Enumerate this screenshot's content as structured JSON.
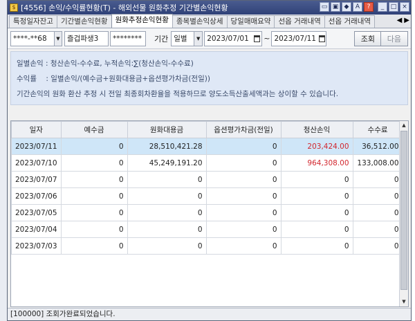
{
  "window": {
    "title": "[4556] 손익/수익률현황(T) - 해외선물 원화추정 기간별손익현황",
    "icon_glyph": "$"
  },
  "tabs": [
    {
      "label": "특정일자잔고",
      "active": false
    },
    {
      "label": "기간별손익현황",
      "active": false
    },
    {
      "label": "원화추정손익현황",
      "active": true
    },
    {
      "label": "종목별손익상세",
      "active": false
    },
    {
      "label": "당일매매요약",
      "active": false
    },
    {
      "label": "선옵 거래내역",
      "active": false
    },
    {
      "label": "선옵 거래내역",
      "active": false
    }
  ],
  "toolbar": {
    "account": "****-**68",
    "account_type": "즐겁파생3",
    "password": "********",
    "period_label": "기간",
    "period_unit": "일별",
    "start_date": "2023/07/01",
    "range_sep": "~",
    "end_date": "2023/07/11",
    "query_label": "조회",
    "next_label": "다음"
  },
  "info": {
    "line1": "일별손익 : 청산손익-수수료, 누적손익:∑(청산손익-수수료)",
    "line2": "수익률    : 일별손익/(예수금+원화대용금+옵션평가차금(전일))",
    "line3": "기간손익의 원화 환산 추정 시 전일 최종회차환율을 적용하므로 양도소득산출세액과는 상이할 수 있습니다."
  },
  "table": {
    "columns": [
      "일자",
      "예수금",
      "원화대용금",
      "옵션평가차금(전일)",
      "청산손익",
      "수수료"
    ],
    "rows": [
      {
        "date": "2023/07/11",
        "deposit": "0",
        "krw_sub": "28,510,421.28",
        "opt_eval": "0",
        "pnl": "203,424.00",
        "fee": "36,512.00",
        "selected": true,
        "pnl_positive": true
      },
      {
        "date": "2023/07/10",
        "deposit": "0",
        "krw_sub": "45,249,191.20",
        "opt_eval": "0",
        "pnl": "964,308.00",
        "fee": "133,008.00",
        "selected": false,
        "pnl_positive": true
      },
      {
        "date": "2023/07/07",
        "deposit": "0",
        "krw_sub": "0",
        "opt_eval": "0",
        "pnl": "0",
        "fee": "0",
        "selected": false,
        "pnl_positive": false
      },
      {
        "date": "2023/07/06",
        "deposit": "0",
        "krw_sub": "0",
        "opt_eval": "0",
        "pnl": "0",
        "fee": "0",
        "selected": false,
        "pnl_positive": false
      },
      {
        "date": "2023/07/05",
        "deposit": "0",
        "krw_sub": "0",
        "opt_eval": "0",
        "pnl": "0",
        "fee": "0",
        "selected": false,
        "pnl_positive": false
      },
      {
        "date": "2023/07/04",
        "deposit": "0",
        "krw_sub": "0",
        "opt_eval": "0",
        "pnl": "0",
        "fee": "0",
        "selected": false,
        "pnl_positive": false
      },
      {
        "date": "2023/07/03",
        "deposit": "0",
        "krw_sub": "0",
        "opt_eval": "0",
        "pnl": "0",
        "fee": "0",
        "selected": false,
        "pnl_positive": false
      }
    ]
  },
  "status": {
    "message": "[100000] 조회가완료되었습니다."
  },
  "colors": {
    "positive_pnl": "#d2262d",
    "selected_row": "#cfe6f8",
    "title_bar": "#2f4178",
    "info_bg": "#dfe8f6"
  }
}
